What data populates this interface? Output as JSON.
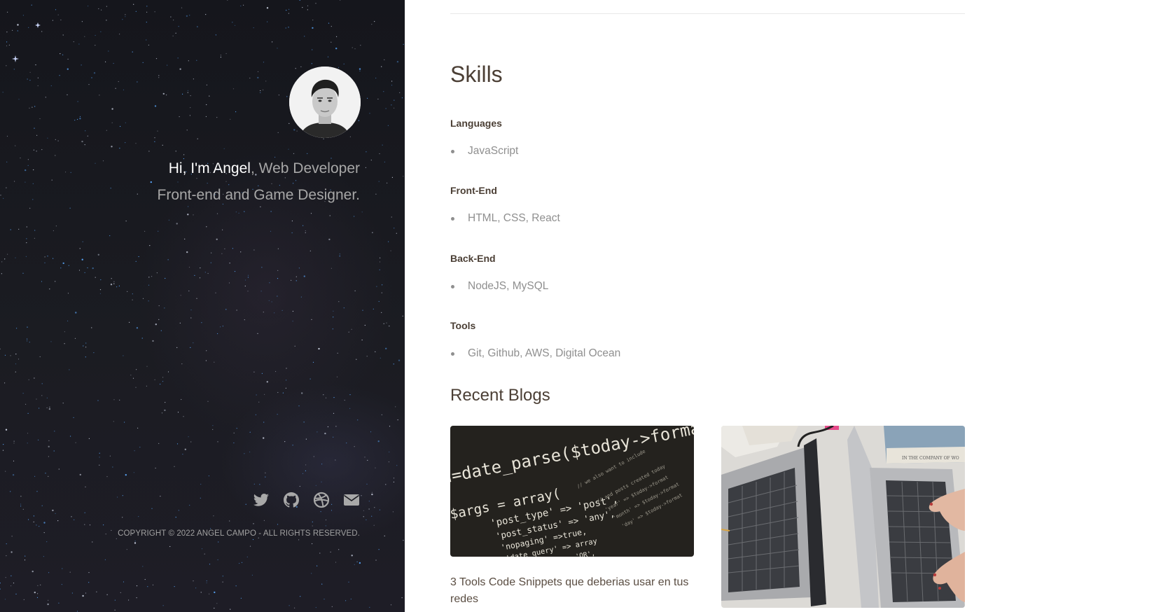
{
  "sidebar": {
    "intro_name": "Hi, I'm Angel",
    "intro_comma": ", ",
    "intro_role_1": "Web Developer",
    "intro_role_2": "Front-end and Game Designer.",
    "avatar_alt": "Angel avatar",
    "social": [
      {
        "icon": "twitter-icon"
      },
      {
        "icon": "github-icon"
      },
      {
        "icon": "dribbble-icon"
      },
      {
        "icon": "mail-icon"
      }
    ],
    "copyright": "COPYRIGHT © 2022 ANGEL CAMPO - ALL RIGHTS RESERVED."
  },
  "skills": {
    "title": "Skills",
    "categories": [
      {
        "name": "Languages",
        "items": [
          "JavaScript"
        ]
      },
      {
        "name": "Front-End",
        "items": [
          "HTML, CSS, React"
        ]
      },
      {
        "name": "Back-End",
        "items": [
          "NodeJS, MySQL"
        ]
      },
      {
        "name": "Tools",
        "items": [
          "Git, Github, AWS, Digital Ocean"
        ]
      }
    ]
  },
  "blogs": {
    "title": "Recent Blogs",
    "posts": [
      {
        "title": "3 Tools Code Snippets que deberias usar en tus redes",
        "image": "code-screen-image"
      },
      {
        "title": "",
        "image": "laptops-desk-image"
      }
    ]
  },
  "colors": {
    "sidebar_bg": "#17181e",
    "heading": "#4b3f35",
    "muted": "#8f8f8f"
  }
}
